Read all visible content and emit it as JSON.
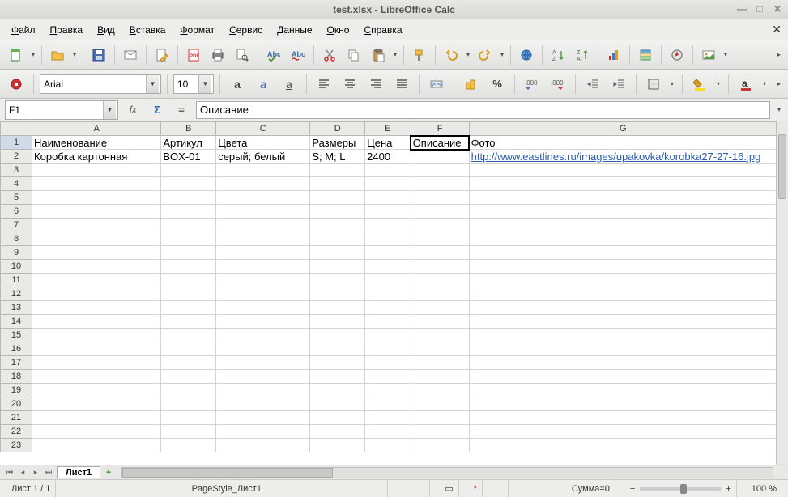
{
  "window": {
    "title": "test.xlsx - LibreOffice Calc"
  },
  "menu": [
    "Файл",
    "Правка",
    "Вид",
    "Вставка",
    "Формат",
    "Сервис",
    "Данные",
    "Окно",
    "Справка"
  ],
  "font": {
    "name": "Arial",
    "size": "10"
  },
  "namebox": "F1",
  "formula": "Описание",
  "cols": [
    "A",
    "B",
    "C",
    "D",
    "E",
    "F",
    "G"
  ],
  "sel_col": "F",
  "rows": 23,
  "headers": {
    "A": "Наименование",
    "B": "Артикул",
    "C": "Цвета",
    "D": "Размеры",
    "E": "Цена",
    "F": "Описание",
    "G": "Фото"
  },
  "row2": {
    "A": "Коробка картонная",
    "B": "BOX-01",
    "C": "серый; белый",
    "D": "S; M; L",
    "E": "2400",
    "F": "",
    "G": "http://www.eastlines.ru/images/upakovka/korobka27-27-16.jpg"
  },
  "tabs": {
    "active": "Лист1"
  },
  "status": {
    "sheet": "Лист 1 / 1",
    "pagestyle": "PageStyle_Лист1",
    "sum": "Сумма=0",
    "zoom": "100 %"
  }
}
